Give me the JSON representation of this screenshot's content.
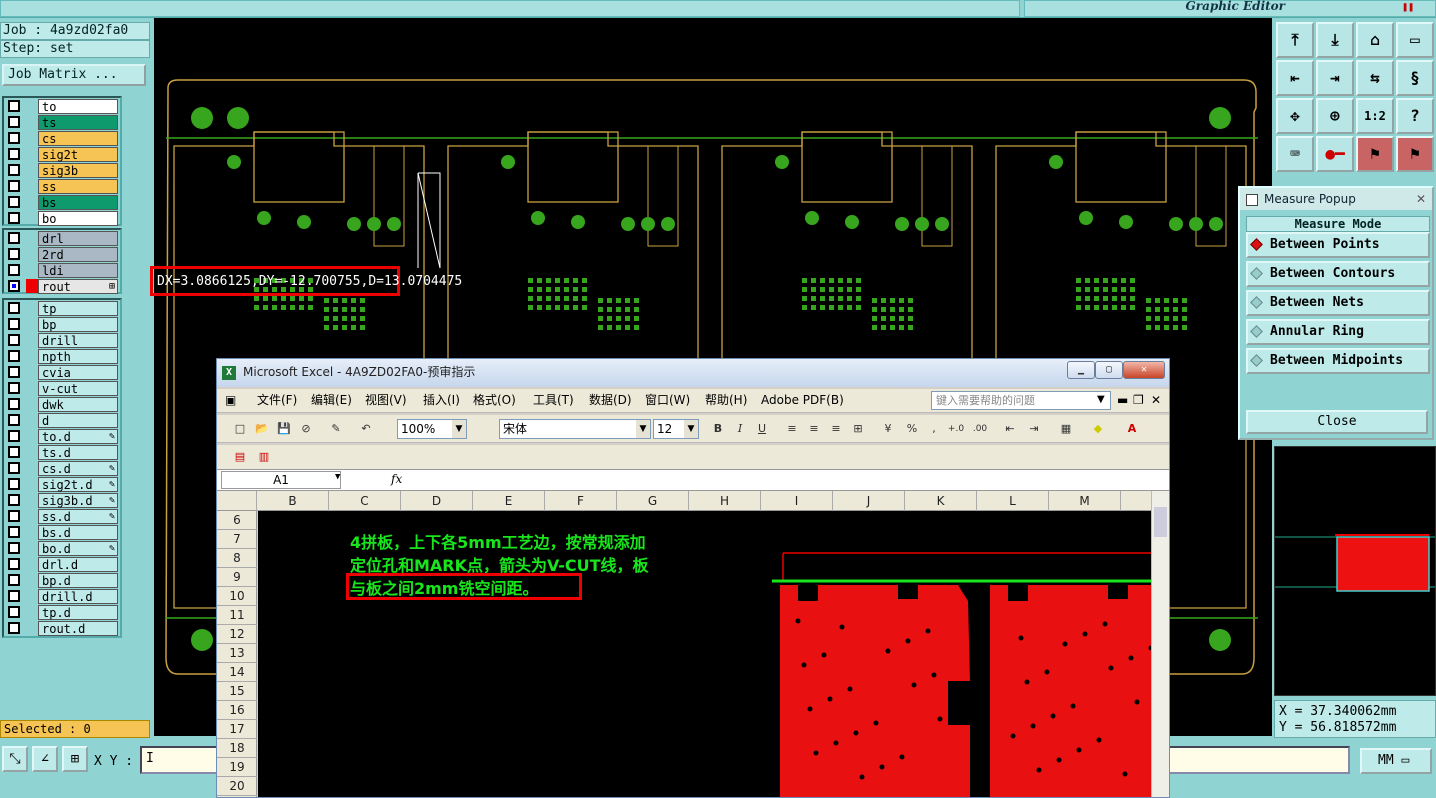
{
  "app": {
    "graphic_editor": "Graphic Editor"
  },
  "job": {
    "job_line": "Job : 4a9zd02fa0",
    "step_line": "Step: set",
    "job_matrix_label": "Job Matrix ..."
  },
  "layers": {
    "group1": [
      {
        "name": "to",
        "color": "#ffffff"
      },
      {
        "name": "ts",
        "color": "#0e9a6c"
      },
      {
        "name": "cs",
        "color": "#f6c454"
      },
      {
        "name": "sig2t",
        "color": "#f6c454"
      },
      {
        "name": "sig3b",
        "color": "#f6c454"
      },
      {
        "name": "ss",
        "color": "#f6c454"
      },
      {
        "name": "bs",
        "color": "#0e9a6c"
      },
      {
        "name": "bo",
        "color": "#ffffff"
      }
    ],
    "group2": [
      {
        "name": "drl",
        "color": "#a9b8c4"
      },
      {
        "name": "2rd",
        "color": "#a9b8c4"
      },
      {
        "name": "ldi",
        "color": "#a9b8c4"
      },
      {
        "name": "rout",
        "color": "#e6e6e6",
        "active": true
      }
    ],
    "group3": [
      {
        "name": "tp"
      },
      {
        "name": "bp"
      },
      {
        "name": "drill"
      },
      {
        "name": "npth"
      },
      {
        "name": "cvia"
      },
      {
        "name": "v-cut"
      },
      {
        "name": "dwk"
      },
      {
        "name": "d"
      },
      {
        "name": "to.d",
        "pen": true
      },
      {
        "name": "ts.d"
      },
      {
        "name": "cs.d",
        "pen": true
      },
      {
        "name": "sig2t.d",
        "pen": true
      },
      {
        "name": "sig3b.d",
        "pen": true
      },
      {
        "name": "ss.d",
        "pen": true
      },
      {
        "name": "bs.d"
      },
      {
        "name": "bo.d",
        "pen": true
      },
      {
        "name": "drl.d"
      },
      {
        "name": "bp.d"
      },
      {
        "name": "drill.d"
      },
      {
        "name": "tp.d"
      },
      {
        "name": "rout.d"
      }
    ]
  },
  "status": {
    "selected": "Selected : 0"
  },
  "measure_result": "DX=3.0866125,DY=-12.700755,D=13.0704475",
  "measure_popup": {
    "title": "Measure Popup",
    "mode_label": "Measure Mode",
    "options": [
      {
        "label": "Between Points",
        "selected": true
      },
      {
        "label": "Between Contours",
        "selected": false
      },
      {
        "label": "Between Nets",
        "selected": false
      },
      {
        "label": "Annular Ring",
        "selected": false
      },
      {
        "label": "Between Midpoints",
        "selected": false
      }
    ],
    "close_label": "Close"
  },
  "coords": {
    "x": "X = 37.340062mm",
    "y": "Y = 56.818572mm"
  },
  "bottom": {
    "xy_label": "X Y :",
    "xy_value": "I",
    "unit": "MM"
  },
  "excel": {
    "title": "Microsoft Excel - 4A9ZD02FA0-预审指示",
    "menu": [
      "文件(F)",
      "编辑(E)",
      "视图(V)",
      "插入(I)",
      "格式(O)",
      "工具(T)",
      "数据(D)",
      "窗口(W)",
      "帮助(H)",
      "Adobe PDF(B)"
    ],
    "help_placeholder": "键入需要帮助的问题",
    "zoom": "100%",
    "font": "宋体",
    "font_size": "12",
    "name_box": "A1",
    "fx": "fx",
    "columns": [
      "B",
      "C",
      "D",
      "E",
      "F",
      "G",
      "H",
      "I",
      "J",
      "K",
      "L",
      "M"
    ],
    "rows": [
      "6",
      "7",
      "8",
      "9",
      "10",
      "11",
      "12",
      "13",
      "14",
      "15",
      "16",
      "17",
      "18",
      "19",
      "20"
    ],
    "note_lines": [
      "4拼板，上下各5mm工艺边，按常规添加",
      "定位孔和MARK点，箭头为V-CUT线，板",
      "与板之间2mm铣空间距。"
    ]
  },
  "colors": {
    "pcb_outline": "#c8a040",
    "pcb_green": "#37a51e",
    "excel_note": "#18e51c",
    "highlight": "#e00000"
  }
}
